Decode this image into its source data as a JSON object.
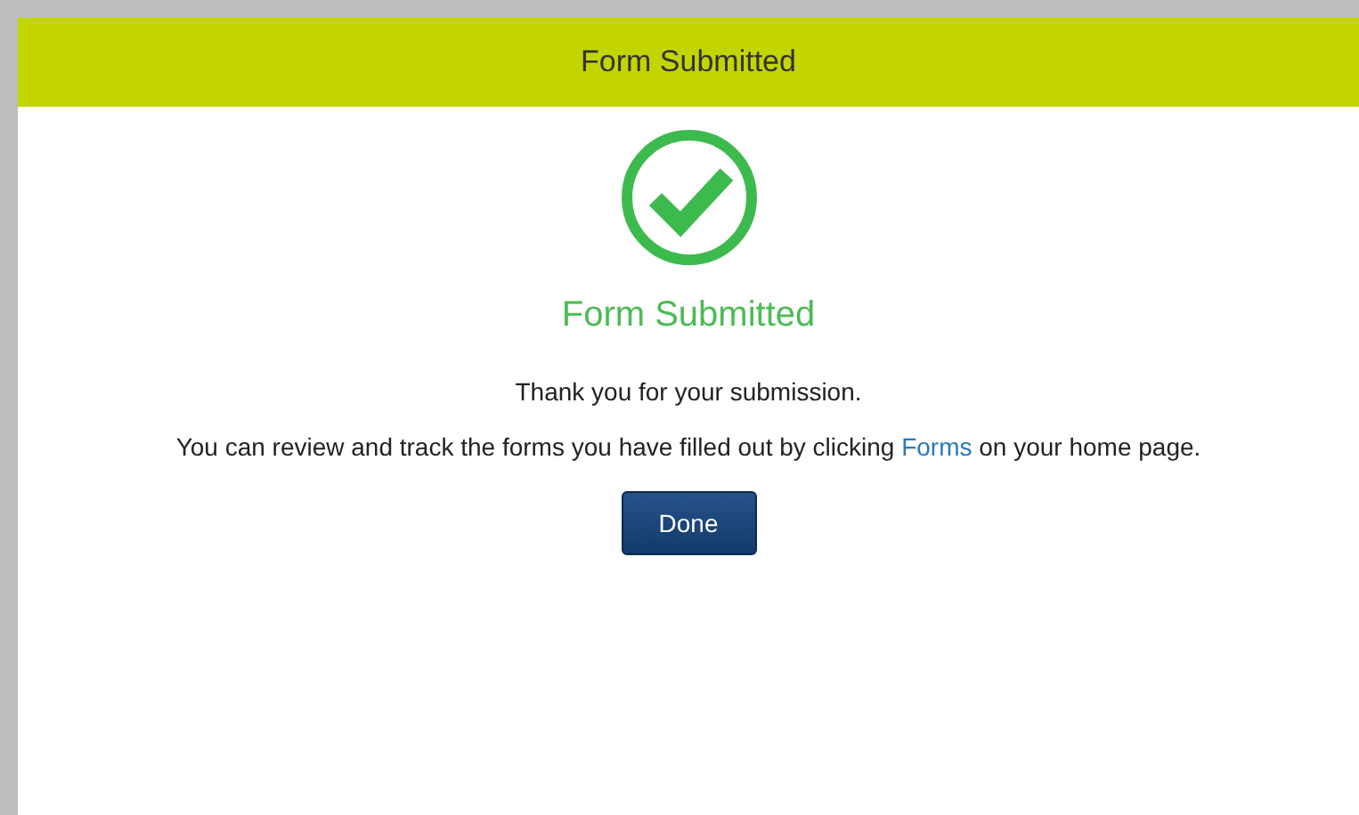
{
  "header": {
    "title": "Form Submitted"
  },
  "confirmation": {
    "title": "Form Submitted",
    "message": "Thank you for your submission.",
    "details": {
      "before": "You can review and track the forms you have filled out by clicking",
      "link": "Forms",
      "after": "on your home page."
    }
  },
  "buttons": [
    {
      "label": "Done"
    }
  ]
}
